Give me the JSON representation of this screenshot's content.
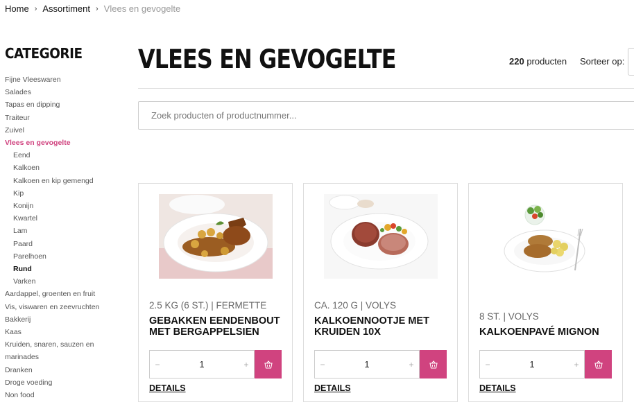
{
  "breadcrumb": {
    "items": [
      "Home",
      "Assortiment",
      "Vlees en gevogelte"
    ],
    "separator": "›"
  },
  "sidebar": {
    "title": "CATEGORIE",
    "items": [
      {
        "label": "Fijne Vleeswaren"
      },
      {
        "label": "Salades"
      },
      {
        "label": "Tapas en dipping"
      },
      {
        "label": "Traiteur"
      },
      {
        "label": "Zuivel"
      },
      {
        "label": "Vlees en gevogelte",
        "active": true
      },
      {
        "label": "Eend",
        "sub": true
      },
      {
        "label": "Kalkoen",
        "sub": true
      },
      {
        "label": "Kalkoen en kip gemengd",
        "sub": true
      },
      {
        "label": "Kip",
        "sub": true
      },
      {
        "label": "Konijn",
        "sub": true
      },
      {
        "label": "Kwartel",
        "sub": true
      },
      {
        "label": "Lam",
        "sub": true
      },
      {
        "label": "Paard",
        "sub": true
      },
      {
        "label": "Parelhoen",
        "sub": true
      },
      {
        "label": "Rund",
        "sub": true,
        "selected": true
      },
      {
        "label": "Varken",
        "sub": true
      },
      {
        "label": "Aardappel, groenten en fruit"
      },
      {
        "label": "Vis, viswaren en zeevruchten"
      },
      {
        "label": "Bakkerij"
      },
      {
        "label": "Kaas"
      },
      {
        "label": "Kruiden, snaren, sauzen en marinades"
      },
      {
        "label": "Dranken"
      },
      {
        "label": "Droge voeding"
      },
      {
        "label": "Non food"
      }
    ]
  },
  "header": {
    "title": "VLEES EN GEVOGELTE",
    "count_number": "220",
    "count_suffix": " producten",
    "sort_label": "Sorteer op:"
  },
  "search": {
    "placeholder": "Zoek producten of productnummer..."
  },
  "products": [
    {
      "meta": "2.5 KG (6 ST.) | FERMETTE",
      "name": "GEBAKKEN EENDENBOUT MET BERGAPPELSIEN",
      "qty": "1",
      "minus": "−",
      "plus": "+",
      "details": "DETAILS",
      "image_icon": "duck-leg-dish-photo"
    },
    {
      "meta": "CA. 120 G | VOLYS",
      "name": "KALKOENNOOTJE MET KRUIDEN 10X",
      "qty": "1",
      "minus": "−",
      "plus": "+",
      "details": "DETAILS",
      "image_icon": "turkey-steak-dish-photo"
    },
    {
      "meta": "8 ST. | VOLYS",
      "name": "KALKOENPAVÉ MIGNON",
      "qty": "1",
      "minus": "−",
      "plus": "+",
      "details": "DETAILS",
      "image_icon": "turkey-pave-dish-photo"
    }
  ],
  "colors": {
    "accent": "#d0437f",
    "text_dark": "#111111",
    "muted": "#999999",
    "border": "#dddddd"
  },
  "icons": {
    "cart": "basket-icon"
  }
}
